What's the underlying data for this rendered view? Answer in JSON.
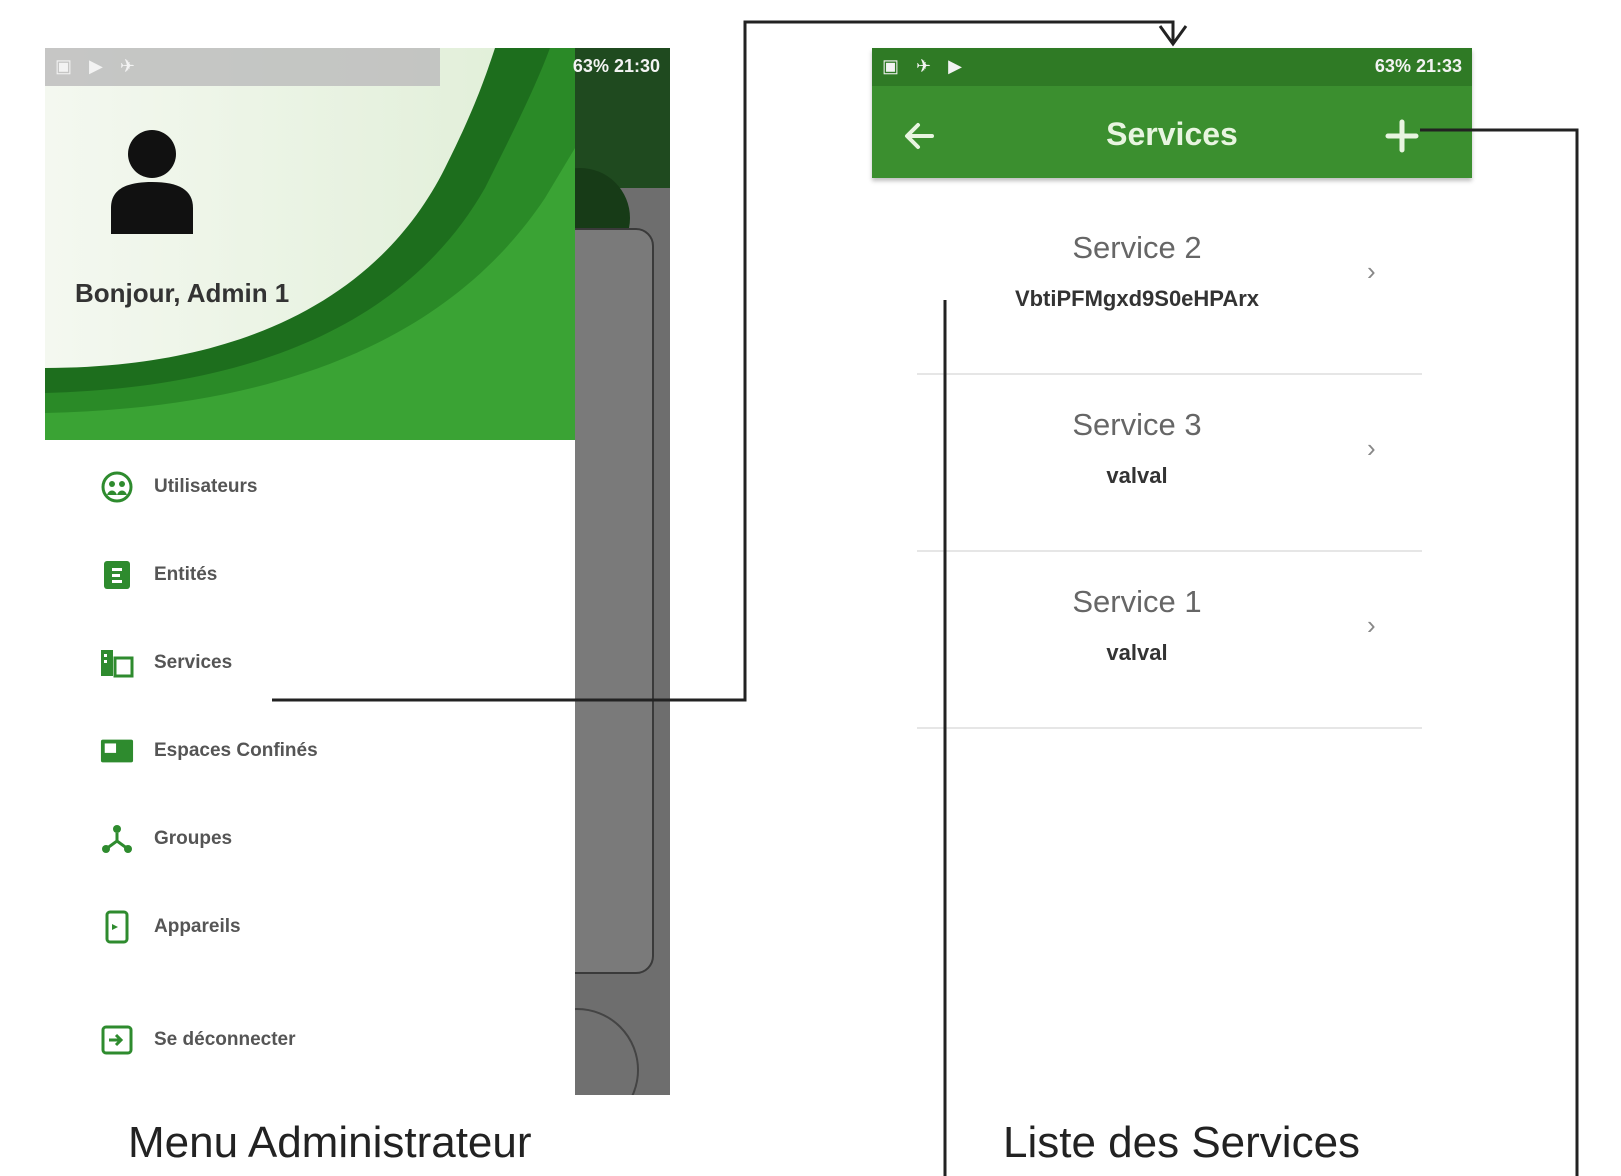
{
  "left_phone": {
    "status_bar": {
      "text": "63% 21:30"
    },
    "greeting": "Bonjour, Admin 1",
    "menu": [
      {
        "label": "Utilisateurs",
        "icon": "users-icon"
      },
      {
        "label": "Entités",
        "icon": "entity-icon"
      },
      {
        "label": "Services",
        "icon": "services-icon"
      },
      {
        "label": "Espaces Confinés",
        "icon": "confined-space-icon"
      },
      {
        "label": "Groupes",
        "icon": "groups-icon"
      },
      {
        "label": "Appareils",
        "icon": "devices-icon"
      },
      {
        "label": "Se déconnecter",
        "icon": "logout-icon"
      }
    ],
    "caption": "Menu Administrateur"
  },
  "right_phone": {
    "status_bar": {
      "text": "63% 21:33"
    },
    "title": "Services",
    "back_icon": "arrow-left-icon",
    "add_icon": "plus-icon",
    "services": [
      {
        "name": "Service 2",
        "description": "VbtiPFMgxd9S0eHPArx"
      },
      {
        "name": "Service 3",
        "description": "valval"
      },
      {
        "name": "Service 1",
        "description": "valval"
      }
    ],
    "chevron": "›",
    "caption": "Liste des Services"
  },
  "colors": {
    "primary_green": "#3b8f2f",
    "dark_green": "#1f6e1f",
    "light_green": "#43a93a"
  }
}
